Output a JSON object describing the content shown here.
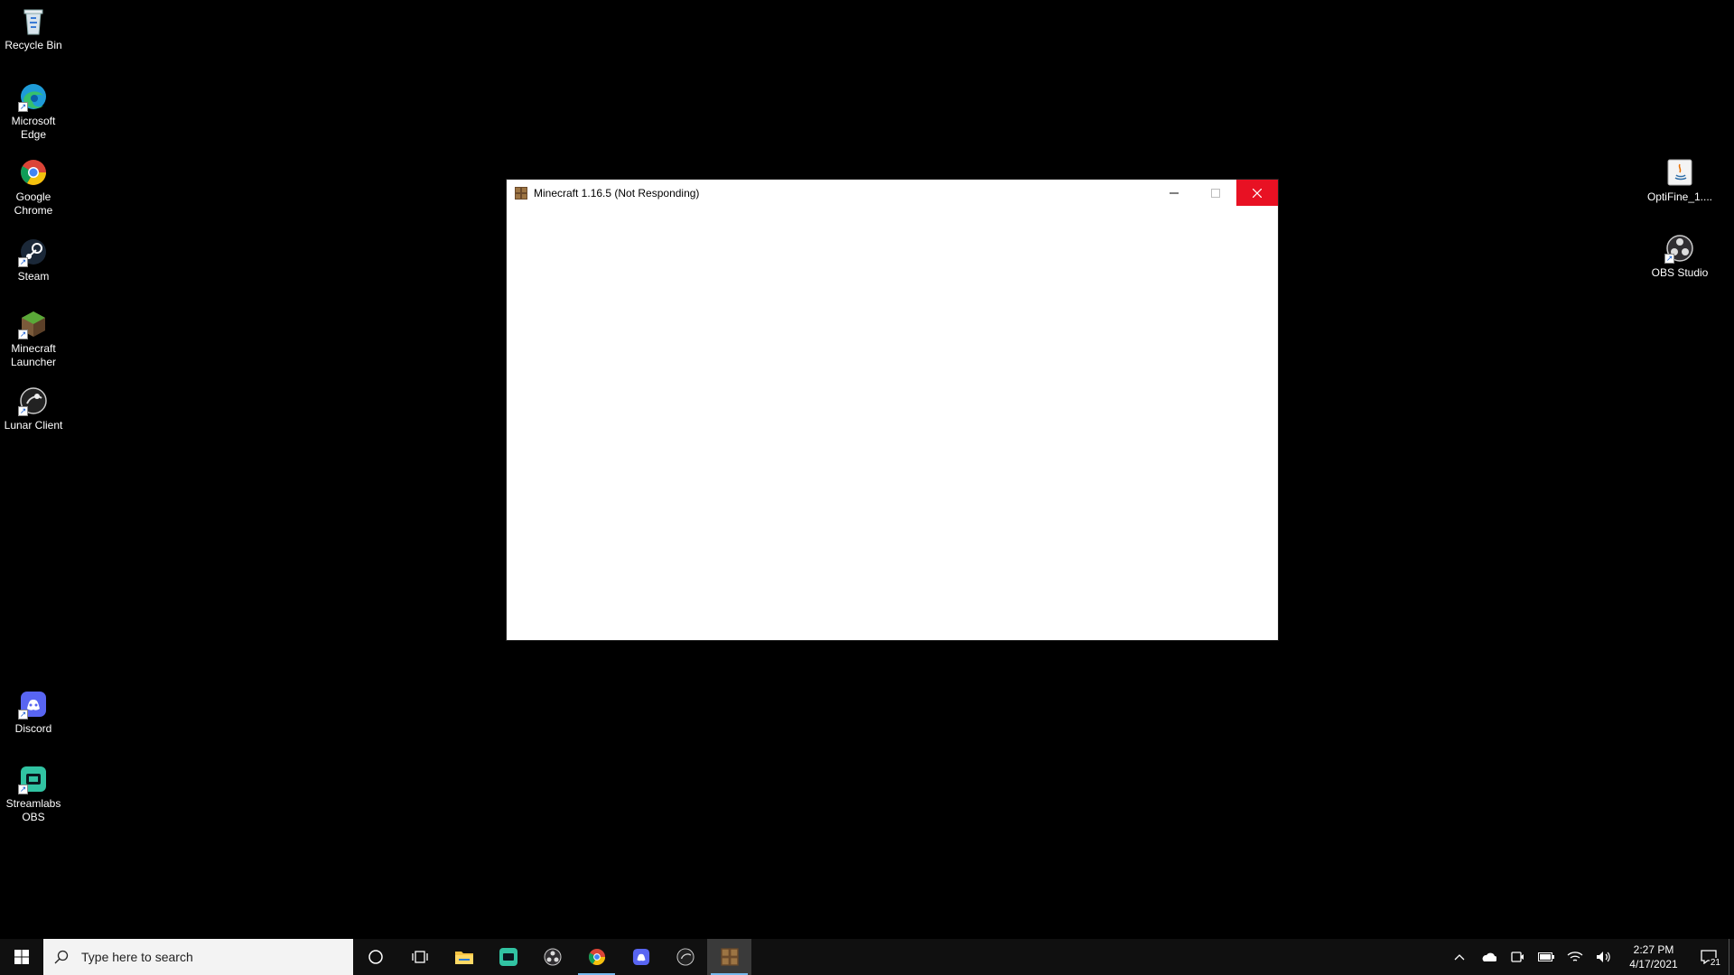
{
  "desktop": {
    "icons_left": [
      {
        "label": "Recycle Bin",
        "icon": "recycle-bin-icon"
      },
      {
        "label": "Microsoft Edge",
        "icon": "edge-icon"
      },
      {
        "label": "Google Chrome",
        "icon": "chrome-icon"
      },
      {
        "label": "Steam",
        "icon": "steam-icon"
      },
      {
        "label": "Minecraft Launcher",
        "icon": "minecraft-launcher-icon"
      },
      {
        "label": "Lunar Client",
        "icon": "lunar-client-icon"
      },
      {
        "label": "Discord",
        "icon": "discord-icon"
      },
      {
        "label": "Streamlabs OBS",
        "icon": "streamlabs-obs-icon"
      }
    ],
    "icons_right": [
      {
        "label": "OptiFine_1....",
        "icon": "java-icon"
      },
      {
        "label": "OBS Studio",
        "icon": "obs-icon"
      }
    ]
  },
  "window": {
    "title": "Minecraft 1.16.5 (Not Responding)",
    "close_color": "#e81123"
  },
  "taskbar": {
    "search_placeholder": "Type here to search",
    "apps": [
      "cortana-icon",
      "task-view-icon",
      "file-explorer-icon",
      "streamlabs-obs-icon",
      "obs-icon",
      "chrome-icon",
      "discord-icon",
      "lunar-client-icon",
      "minecraft-icon"
    ],
    "active_app": "minecraft-icon",
    "clock": {
      "time": "2:27 PM",
      "date": "4/17/2021"
    },
    "notification_count": "21",
    "accent": "#76b9ed"
  }
}
